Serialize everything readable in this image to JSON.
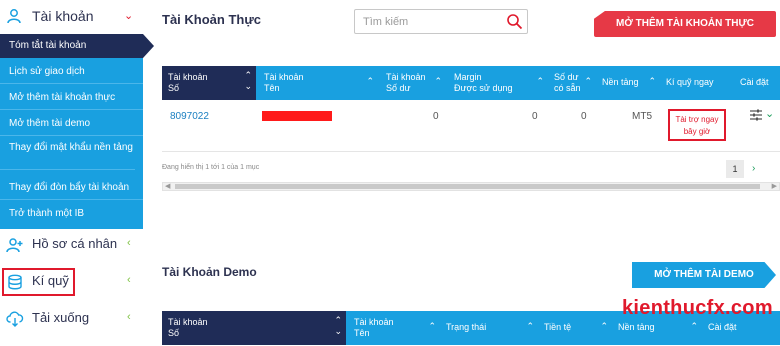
{
  "sidebar": {
    "header": "Tài khoản",
    "items": [
      {
        "label": "Tóm tắt tài khoản"
      },
      {
        "label": "Lịch sử giao dịch"
      },
      {
        "label": "Mở thêm tài khoản thực"
      },
      {
        "label": "Mở thêm tài demo"
      },
      {
        "label": "Thay đổi mật khẩu nền tảng"
      },
      {
        "label": "Thay đổi đòn bẩy tài khoản"
      },
      {
        "label": "Trở thành một IB"
      }
    ],
    "sections": [
      {
        "label": "Hồ sơ cá nhân"
      },
      {
        "label": "Kí quỹ"
      },
      {
        "label": "Tải xuống"
      }
    ]
  },
  "real": {
    "title": "Tài Khoản Thực",
    "search_placeholder": "Tìm kiếm",
    "open_button": "MỞ THÊM TÀI KHOẢN THỰC",
    "columns": [
      {
        "l1": "Tài khoản",
        "l2": "Số"
      },
      {
        "l1": "Tài khoản",
        "l2": "Tên"
      },
      {
        "l1": "Tài khoản",
        "l2": "Số dư"
      },
      {
        "l1": "Margin",
        "l2": "Được sử dụng"
      },
      {
        "l1": "Số dư",
        "l2": "có sẵn"
      },
      {
        "l1": "Nền tảng",
        "l2": ""
      },
      {
        "l1": "Kí quỹ ngay",
        "l2": ""
      },
      {
        "l1": "Cài đặt",
        "l2": ""
      }
    ],
    "row": {
      "account_no": "8097022",
      "balance": "0",
      "margin": "0",
      "available": "0",
      "platform": "MT5",
      "deposit_button": "Tài trợ ngay bây giờ"
    },
    "footer_info": "Đang hiển thị 1 tới 1 của 1 mục",
    "page": "1"
  },
  "demo": {
    "title": "Tài Khoản Demo",
    "open_button": "MỞ THÊM TÀI DEMO",
    "columns": [
      {
        "l1": "Tài khoản",
        "l2": "Số"
      },
      {
        "l1": "Tài khoản",
        "l2": "Tên"
      },
      {
        "l1": "Trạng thái",
        "l2": ""
      },
      {
        "l1": "Tiền tệ",
        "l2": ""
      },
      {
        "l1": "Nền tảng",
        "l2": ""
      },
      {
        "l1": "Cài đặt",
        "l2": ""
      }
    ]
  },
  "watermark": "kienthucfx.com",
  "colors": {
    "brand_blue": "#19a0e0",
    "navy": "#1f2c57",
    "red": "#e63946"
  }
}
